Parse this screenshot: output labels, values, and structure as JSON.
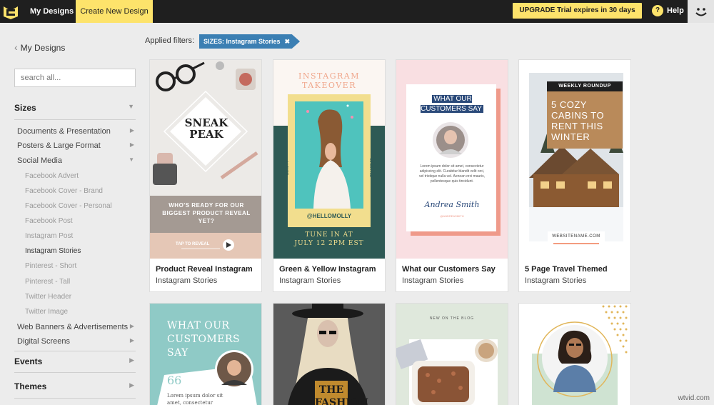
{
  "topbar": {
    "my_designs": "My Designs",
    "create_new": "Create New Design",
    "upgrade": "UPGRADE Trial expires in 30 days",
    "help_icon": "?",
    "help": "Help",
    "logo_icon": "logo-icon",
    "avatar_icon": "smiley-icon"
  },
  "sidebar": {
    "back": "My Designs",
    "search_placeholder": "search all...",
    "sizes": "Sizes",
    "categories": [
      "Documents & Presentation",
      "Posters & Large Format",
      "Social Media"
    ],
    "social_items": [
      "Facebook Advert",
      "Facebook Cover - Brand",
      "Facebook Cover - Personal",
      "Facebook Post",
      "Instagram Post",
      "Instagram Stories",
      "Pinterest - Short",
      "Pinterest - Tall",
      "Twitter Header",
      "Twitter Image"
    ],
    "more_categories": [
      "Web Banners & Advertisements",
      "Digital Screens"
    ],
    "events": "Events",
    "themes": "Themes"
  },
  "filters": {
    "label": "Applied filters:",
    "chip": "SIZES:  Instagram Stories",
    "chip_close": "✖"
  },
  "cards": [
    {
      "title": "Product Reveal Instagram",
      "subtitle": "Instagram Stories"
    },
    {
      "title": "Green & Yellow Instagram",
      "subtitle": "Instagram Stories"
    },
    {
      "title": "What our Customers Say",
      "subtitle": "Instagram Stories"
    },
    {
      "title": "5 Page Travel Themed",
      "subtitle": "Instagram Stories"
    }
  ],
  "thumbs": {
    "t1_headline": "SNEAK PEAK",
    "t1_caption": "WHO'S READY FOR OUR BIGGEST PRODUCT REVEAL YET?",
    "t1_tap": "TAP TO REVEAL",
    "t2_headline": "INSTAGRAM TAKEOVER",
    "t2_handle": "@HELLOMOLLY",
    "t2_side_left": "BEAUTY",
    "t2_side_right": "LIFESTYLE",
    "t2_tune": "TUNE IN AT",
    "t2_time": "JULY 12 2PM EST",
    "t3_headline": "WHAT OUR CUSTOMERS SAY",
    "t3_body": "Lorem ipsum dolor sit amet, consectetur adipiscing elit. Curabitur blandit velit orci, vel tristique nulla vel. Aenean orci mauris, pellentesque quis tincidunt.",
    "t3_signature": "Andrea Smith",
    "t3_handle": "@ANDREASMITH",
    "t4_tag": "WEEKLY ROUNDUP",
    "t4_headline": "5 COZY CABINS TO RENT THIS WINTER",
    "t4_site": "WEBSITENAME.COM",
    "t5_headline": "WHAT OUR CUSTOMERS SAY",
    "t5_quote": "66",
    "t5_body": "Lorem ipsum dolor sit amet, consectetur adipiscing elit.",
    "t6_headline": "THE FASHION",
    "t7_tag": "NEW ON THE BLOG"
  },
  "watermark": "wtvid.com"
}
